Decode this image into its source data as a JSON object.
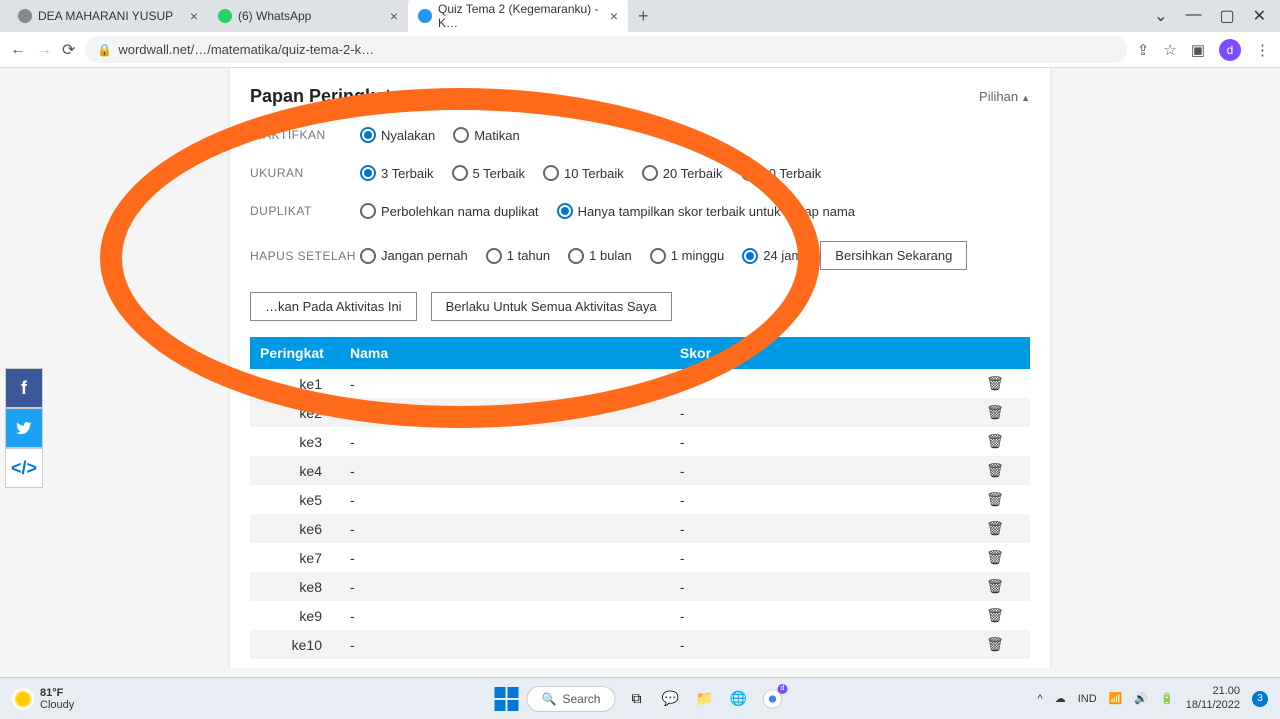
{
  "tabs": [
    {
      "title": "DEA MAHARANI YUSUP",
      "favicon": "#888"
    },
    {
      "title": "(6) WhatsApp",
      "favicon": "#25d366"
    },
    {
      "title": "Quiz Tema 2 (Kegemaranku) - K…",
      "favicon": "#2196f3",
      "active": true
    }
  ],
  "url": "wordwall.net/…/matematika/quiz-tema-2-k…",
  "profile_letter": "d",
  "card": {
    "title": "Papan Peringkat",
    "options_label": "Pilihan"
  },
  "rows": {
    "enabled": {
      "label": "DIAKTIFKAN",
      "on": "Nyalakan",
      "off": "Matikan"
    },
    "size": {
      "label": "UKURAN",
      "opts": [
        "3 Terbaik",
        "5 Terbaik",
        "10 Terbaik",
        "20 Terbaik",
        "40 Terbaik"
      ]
    },
    "dup": {
      "label": "DUPLIKAT",
      "allow": "Perbolehkan nama duplikat",
      "best": "Hanya tampilkan skor terbaik untuk setiap nama"
    },
    "clear": {
      "label": "HAPUS SETELAH",
      "opts": [
        "Jangan pernah",
        "1 tahun",
        "1 bulan",
        "1 minggu",
        "24 jam"
      ],
      "btn": "Bersihkan Sekarang"
    }
  },
  "buttons": {
    "apply_this": "…kan Pada Aktivitas Ini",
    "apply_all": "Berlaku Untuk Semua Aktivitas Saya"
  },
  "table": {
    "headers": {
      "rank": "Peringkat",
      "name": "Nama",
      "score": "Skor"
    },
    "rows": [
      {
        "rank": "ke1",
        "name": "-",
        "score": "-"
      },
      {
        "rank": "ke2",
        "name": "-",
        "score": "-"
      },
      {
        "rank": "ke3",
        "name": "-",
        "score": "-"
      },
      {
        "rank": "ke4",
        "name": "-",
        "score": "-"
      },
      {
        "rank": "ke5",
        "name": "-",
        "score": "-"
      },
      {
        "rank": "ke6",
        "name": "-",
        "score": "-"
      },
      {
        "rank": "ke7",
        "name": "-",
        "score": "-"
      },
      {
        "rank": "ke8",
        "name": "-",
        "score": "-"
      },
      {
        "rank": "ke9",
        "name": "-",
        "score": "-"
      },
      {
        "rank": "ke10",
        "name": "-",
        "score": "-"
      }
    ]
  },
  "taskbar": {
    "temp": "81°F",
    "cond": "Cloudy",
    "search": "Search",
    "lang": "IND",
    "time": "21.00",
    "date": "18/11/2022",
    "notif": "3"
  }
}
